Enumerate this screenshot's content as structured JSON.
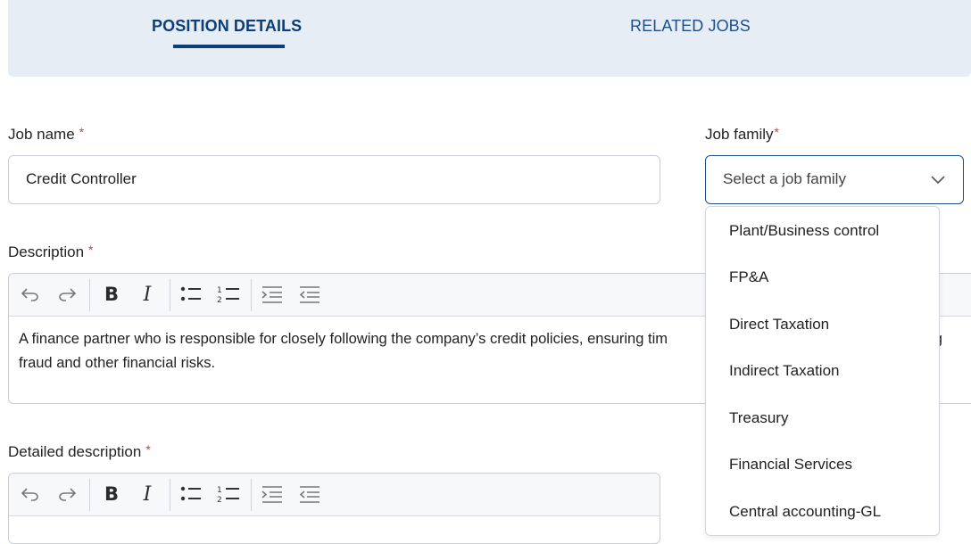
{
  "tabs": [
    {
      "label": "POSITION DETAILS",
      "active": true
    },
    {
      "label": "RELATED JOBS",
      "active": false
    }
  ],
  "job_name": {
    "label": "Job name",
    "required_mark": "*",
    "value": "Credit Controller"
  },
  "job_family": {
    "label": "Job family",
    "required_mark": "*",
    "placeholder": "Select a job family",
    "options": [
      "Plant/Business control",
      "FP&A",
      "Direct Taxation",
      "Indirect Taxation",
      "Treasury",
      "Financial Services",
      "Central accounting-GL"
    ]
  },
  "description": {
    "label": "Description",
    "required_mark": "*",
    "text": "A finance partner who is responsible for closely following the company’s credit policies, ensuring tim                 ring fraud and other financial risks."
  },
  "detailed_description": {
    "label": "Detailed description",
    "required_mark": "*"
  },
  "toolbar_icons": [
    "undo-icon",
    "redo-icon",
    "bold-icon",
    "italic-icon",
    "bullet-list-icon",
    "numbered-list-icon",
    "indent-icon",
    "outdent-icon"
  ],
  "colors": {
    "accent": "#0c3e7a",
    "tab_bg": "#e6edf5",
    "required": "#d23a3a",
    "select_border": "#1f4d8a"
  }
}
